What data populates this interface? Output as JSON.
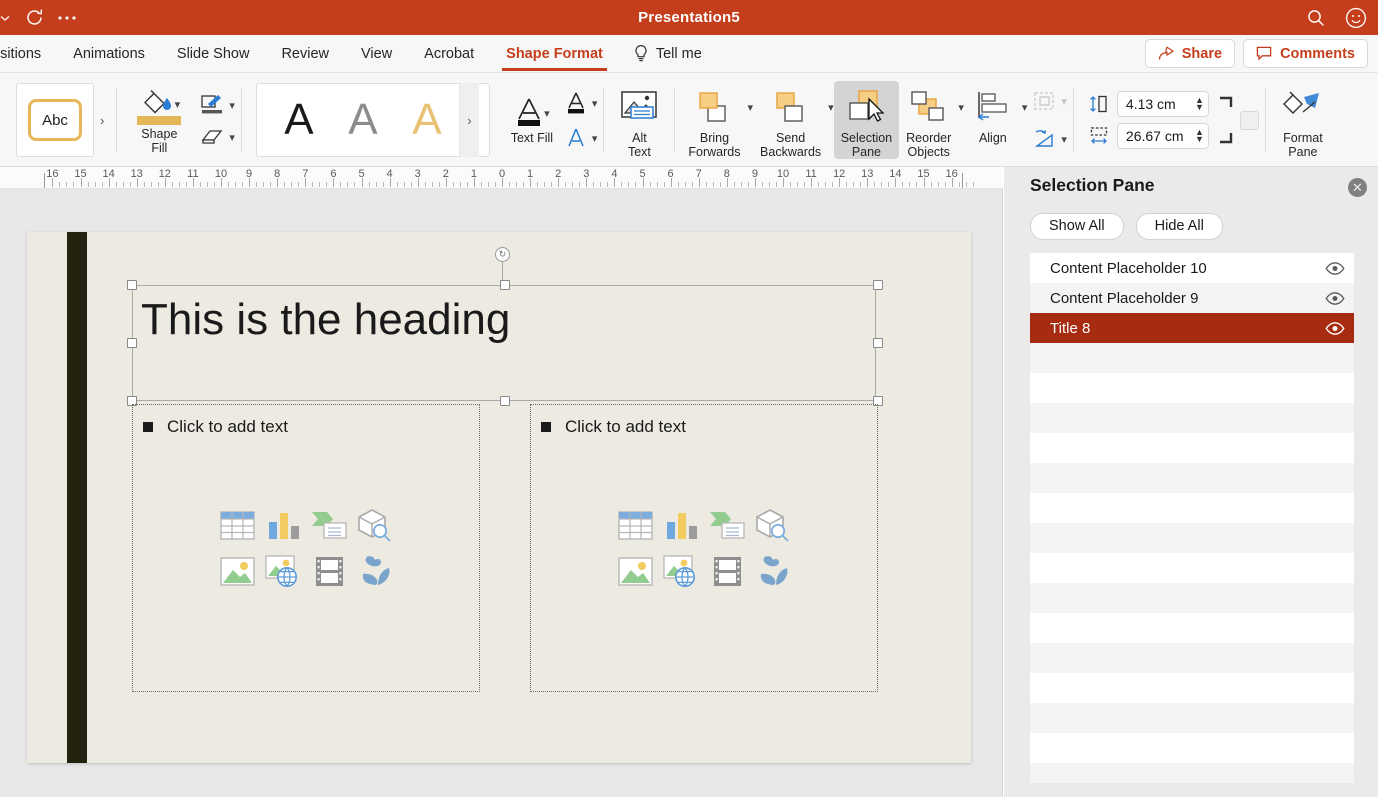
{
  "titlebar": {
    "title": "Presentation5",
    "refresh_icon": "refresh-icon",
    "more_icon": "ellipsis-icon",
    "search_icon": "search-icon",
    "account_icon": "account-smiley-icon"
  },
  "tabs": [
    {
      "label": "nsitions",
      "active": false
    },
    {
      "label": "Animations",
      "active": false
    },
    {
      "label": "Slide Show",
      "active": false
    },
    {
      "label": "Review",
      "active": false
    },
    {
      "label": "View",
      "active": false
    },
    {
      "label": "Acrobat",
      "active": false
    },
    {
      "label": "Shape Format",
      "active": true
    }
  ],
  "tellme": {
    "label": "Tell me",
    "icon": "lightbulb-icon"
  },
  "header_actions": {
    "share": {
      "label": "Share",
      "icon": "share-icon"
    },
    "comments": {
      "label": "Comments",
      "icon": "comment-icon"
    }
  },
  "ribbon": {
    "shape_styles": {
      "thumb_label": "Abc",
      "more": "›"
    },
    "shape_fill": {
      "label_line1": "Shape",
      "label_line2": "Fill",
      "swatch_color": "#e3b656",
      "icon": "fill-bucket-icon"
    },
    "shape_outline": {
      "icon": "shape-outline-icon"
    },
    "shape_effects": {
      "icon": "shape-effects-icon"
    },
    "wordart": {
      "sample1": "A",
      "sample2": "A",
      "sample3": "A",
      "more": "›"
    },
    "text_fill": {
      "label": "Text Fill",
      "icon": "text-fill-icon"
    },
    "text_outline": {
      "icon": "text-outline-icon"
    },
    "text_effects": {
      "icon": "text-effects-icon"
    },
    "alt_text": {
      "label_line1": "Alt",
      "label_line2": "Text",
      "icon": "alt-text-icon"
    },
    "bring_forwards": {
      "label_line1": "Bring",
      "label_line2": "Forwards",
      "icon": "bring-forwards-icon"
    },
    "send_backwards": {
      "label_line1": "Send",
      "label_line2": "Backwards",
      "icon": "send-backwards-icon"
    },
    "selection_pane": {
      "label_line1": "Selection",
      "label_line2": "Pane",
      "icon": "selection-pane-icon",
      "pressed": true
    },
    "reorder_objects": {
      "label_line1": "Reorder",
      "label_line2": "Objects",
      "icon": "reorder-objects-icon"
    },
    "align": {
      "label": "Align",
      "icon": "align-icon"
    },
    "group": {
      "icon": "group-objects-icon"
    },
    "rotate": {
      "icon": "rotate-icon"
    },
    "size": {
      "height": {
        "value": "4.13 cm",
        "icon": "shape-height-icon"
      },
      "width": {
        "value": "26.67 cm",
        "icon": "shape-width-icon"
      }
    },
    "format_pane": {
      "label_line1": "Format",
      "label_line2": "Pane",
      "icon": "format-pane-icon"
    }
  },
  "ruler": {
    "left_labels": [
      "16",
      "15",
      "14",
      "13",
      "12",
      "11",
      "10",
      "9",
      "8",
      "7",
      "6",
      "5",
      "4",
      "3",
      "2",
      "1"
    ],
    "right_labels": [
      "0",
      "1",
      "2",
      "3",
      "4",
      "5",
      "6",
      "7",
      "8",
      "9",
      "10",
      "11",
      "12",
      "13",
      "14",
      "15",
      "16"
    ],
    "unit": "cm"
  },
  "slide": {
    "background_color": "#edebe1",
    "accent_bar_color": "#22220f",
    "title_placeholder": {
      "text": "This is the heading",
      "selected": true
    },
    "content_placeholders": [
      {
        "prompt": "Click to add text",
        "bullet": "■"
      },
      {
        "prompt": "Click to add text",
        "bullet": "■"
      }
    ],
    "insert_icons": [
      "table-icon",
      "chart-icon",
      "smartart-icon",
      "3d-model-icon",
      "picture-icon",
      "online-picture-icon",
      "video-icon",
      "icons-icon"
    ]
  },
  "selection_pane": {
    "title": "Selection Pane",
    "close_icon": "close-icon",
    "show_all": "Show All",
    "hide_all": "Hide All",
    "items": [
      {
        "name": "Content Placeholder 10",
        "visible": true,
        "selected": false
      },
      {
        "name": "Content Placeholder 9",
        "visible": true,
        "selected": false
      },
      {
        "name": "Title 8",
        "visible": true,
        "selected": true
      }
    ],
    "empty_row_count": 15,
    "selected_color": "#a62b10"
  },
  "colors": {
    "titlebar": "#c43e1c",
    "accent": "#c43e1c",
    "ribbon_bg": "#f7f7f7",
    "canvas_bg": "#e8e8e8"
  }
}
